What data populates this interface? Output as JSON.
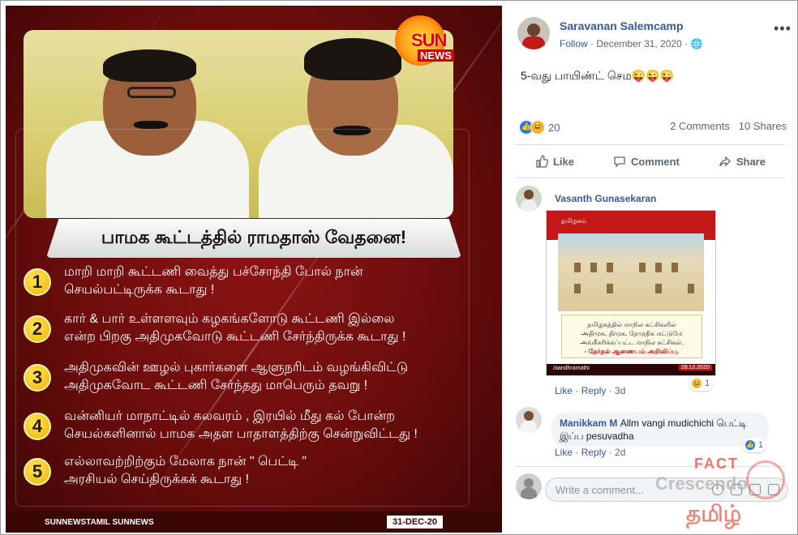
{
  "poster": {
    "logo_line1": "SUN",
    "logo_line2": "NEWS",
    "title": "பாமக கூட்டத்தில் ராமதாஸ் வேதனை!",
    "items": [
      {
        "number": "1",
        "line1": "மாறி மாறி கூட்டணி வைத்து பச்சோந்தி போல் நான்",
        "line2": "செயல்பட்டிருக்க கூடாது !"
      },
      {
        "number": "2",
        "line1": "கார் & பார் உள்ளளவும் கழகங்களோடு கூட்டணி இல்லை",
        "line2": "என்ற பிறகு அதிமுகவோடு கூட்டணி சேர்ந்திருக்க கூடாது !"
      },
      {
        "number": "3",
        "line1": "அதிமுகவின் ஊழல் புகார்களை ஆளுநரிடம் வழங்கிவிட்டு",
        "line2": "அதிமுகவோட கூட்டணி சேர்ந்தது மாபெரும் தவறு !"
      },
      {
        "number": "4",
        "line1": "வன்னியர் மாநாட்டில் கலவரம் , இரயில் மீது கல் போன்ற",
        "line2": "செயல்களினால் பாமக அதள பாதாளத்திற்கு சென்றுவிட்டது !"
      },
      {
        "number": "5",
        "line1": "எல்லாவற்றிற்கும் மேலாக நான் \" பெட்டி \"",
        "line2": "அரசியல் செய்திருக்கக் கூடாது !"
      }
    ],
    "footer_social": "SUNNEWSTAMIL  SUNNEWS",
    "footer_date": "31-DEC-20"
  },
  "post": {
    "author": "Saravanan Salemcamp",
    "follow": "Follow",
    "date": "December 31, 2020",
    "text": "5-வது பாயிண்ட் செம😜😜😜",
    "reaction_count": "20",
    "comments_count": "2 Comments",
    "shares_count": "10 Shares",
    "actions": {
      "like": "Like",
      "comment": "Comment",
      "share": "Share"
    }
  },
  "comments": [
    {
      "author": "Vasanth Gunasekaran",
      "image": {
        "header": "தமிழகம்",
        "caption_line1": "தமிழகத்தில் மாநில கட்சிகளில்",
        "caption_line2": "அதிமுக, திமுக, தேமுதிக மட்டுமே",
        "caption_line3": "அங்கீகரிக்கப்பட்ட மாநில கட்சிகள்.",
        "caption_source": "- தேர்தல் ஆணையம் அறிவிப்பு.",
        "footer_handle": "/aandhramathi",
        "footer_date": "28.12.2020"
      },
      "like": "Like",
      "reply": "Reply",
      "time": "3d",
      "reactions": "1"
    },
    {
      "author": "Manikkam M",
      "text_line1": "Allm vangi mudichichi பெட்டி",
      "text_line2": "இப்ப pesuvadha",
      "like": "Like",
      "reply": "Reply",
      "time": "2d",
      "reactions": "1"
    }
  ],
  "write_comment": {
    "placeholder": "Write a comment..."
  },
  "watermark": {
    "fact": "FACT",
    "crescendo": "Crescendo",
    "tamil": "தமிழ்"
  },
  "colors": {
    "fb_blue": "#385898",
    "poster_red": "#6a0c0c",
    "accent_yellow": "#f0b400"
  }
}
